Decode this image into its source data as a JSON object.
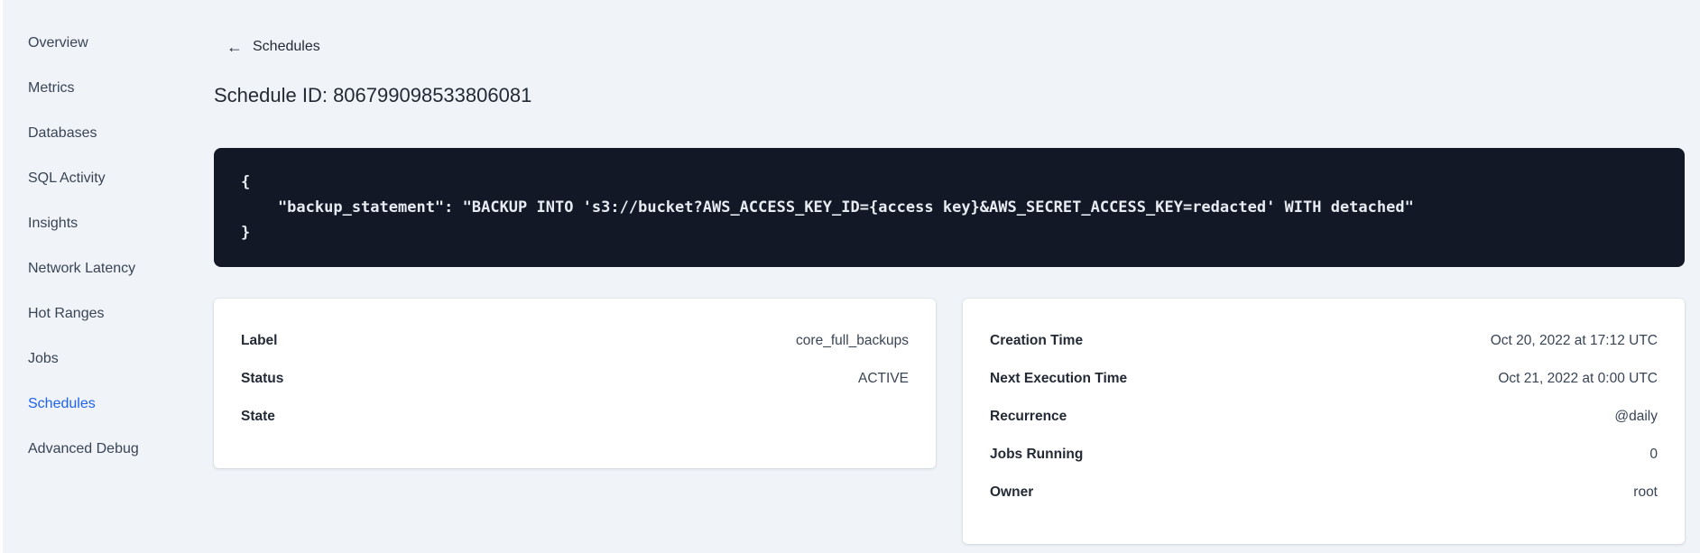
{
  "sidebar": {
    "items": [
      {
        "label": "Overview",
        "active": false
      },
      {
        "label": "Metrics",
        "active": false
      },
      {
        "label": "Databases",
        "active": false
      },
      {
        "label": "SQL Activity",
        "active": false
      },
      {
        "label": "Insights",
        "active": false
      },
      {
        "label": "Network Latency",
        "active": false
      },
      {
        "label": "Hot Ranges",
        "active": false
      },
      {
        "label": "Jobs",
        "active": false
      },
      {
        "label": "Schedules",
        "active": true
      },
      {
        "label": "Advanced Debug",
        "active": false
      }
    ]
  },
  "header": {
    "back_icon": "arrow-left",
    "back_label": "Schedules",
    "title": "Schedule ID: 806799098533806081"
  },
  "code_block": {
    "lines": [
      "{",
      "    \"backup_statement\": \"BACKUP INTO 's3://bucket?AWS_ACCESS_KEY_ID={access key}&AWS_SECRET_ACCESS_KEY=redacted' WITH detached\"",
      "}"
    ]
  },
  "details_card": {
    "rows": [
      {
        "label": "Label",
        "value": "core_full_backups"
      },
      {
        "label": "Status",
        "value": "ACTIVE"
      },
      {
        "label": "State",
        "value": ""
      }
    ]
  },
  "schedule_card": {
    "rows": [
      {
        "label": "Creation Time",
        "value": "Oct 20, 2022 at 17:12 UTC"
      },
      {
        "label": "Next Execution Time",
        "value": "Oct 21, 2022 at 0:00 UTC"
      },
      {
        "label": "Recurrence",
        "value": "@daily"
      },
      {
        "label": "Jobs Running",
        "value": "0"
      },
      {
        "label": "Owner",
        "value": "root"
      }
    ]
  },
  "colors": {
    "accent_blue": "#1f63ec",
    "code_background": "#131826",
    "page_background": "#f0f3f8",
    "text_primary": "#242a35",
    "text_secondary": "#394455"
  }
}
